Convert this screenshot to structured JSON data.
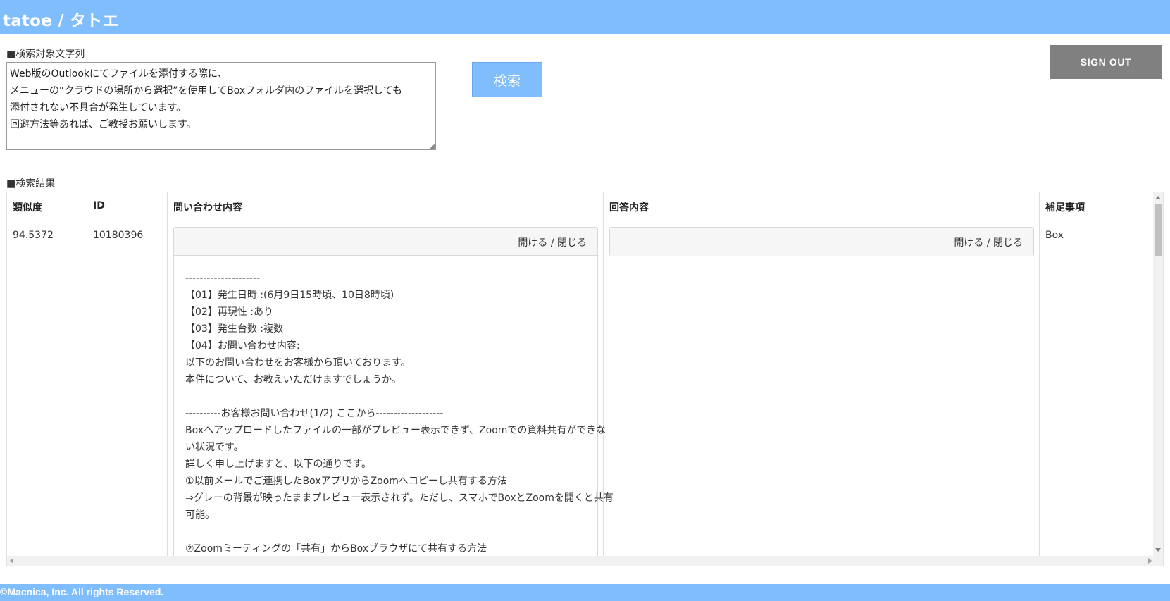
{
  "header": {
    "title": "tatoe / タトエ"
  },
  "query": {
    "label": "■検索対象文字列",
    "text": "Web版のOutlookにてファイルを添付する際に、\nメニューの“クラウドの場所から選択”を使用してBoxフォルダ内のファイルを選択しても\n添付されない不具合が発生しています。\n回避方法等あれば、ご教授お願いします。"
  },
  "search_button": "検索",
  "signout_button": "SIGN OUT",
  "results": {
    "label": "■検索結果",
    "columns": {
      "similarity": "類似度",
      "id": "ID",
      "inquiry": "問い合わせ内容",
      "answer": "回答内容",
      "notes": "補足事項"
    },
    "rows": [
      {
        "similarity": "94.5372",
        "id": "10180396",
        "inquiry_toggle": "開ける / 閉じる",
        "answer_toggle": "開ける / 閉じる",
        "notes": "Box",
        "inquiry_lines": [
          "---------------------",
          "【01】発生日時 :(6月9日15時頃、10日8時頃)",
          "【02】再現性 :あり",
          "【03】発生台数 :複数",
          "【04】お問い合わせ内容:",
          "以下のお問い合わせをお客様から頂いております。",
          "本件について、お教えいただけますでしょうか。",
          "",
          "----------お客様お問い合わせ(1/2) ここから-------------------",
          "Boxへアップロードしたファイルの一部がプレビュー表示できず、Zoomでの資料共有ができな",
          "い状況です。",
          "詳しく申し上げますと、以下の通りです。",
          "①以前メールでご連携したBoxアプリからZoomへコピーし共有する方法",
          "⇒グレーの背景が映ったままプレビュー表示されず。ただし、スマホでBoxとZoomを開くと共有",
          "可能。",
          "",
          "②Zoomミーティングの「共有」からBoxブラウザにて共有する方法"
        ]
      }
    ]
  },
  "footer": {
    "copyright": "©Macnica, Inc. All rights Reserved."
  },
  "colors": {
    "header_bg": "#80bdfd",
    "button_bg": "#80bdfd",
    "signout_bg": "#808080"
  }
}
